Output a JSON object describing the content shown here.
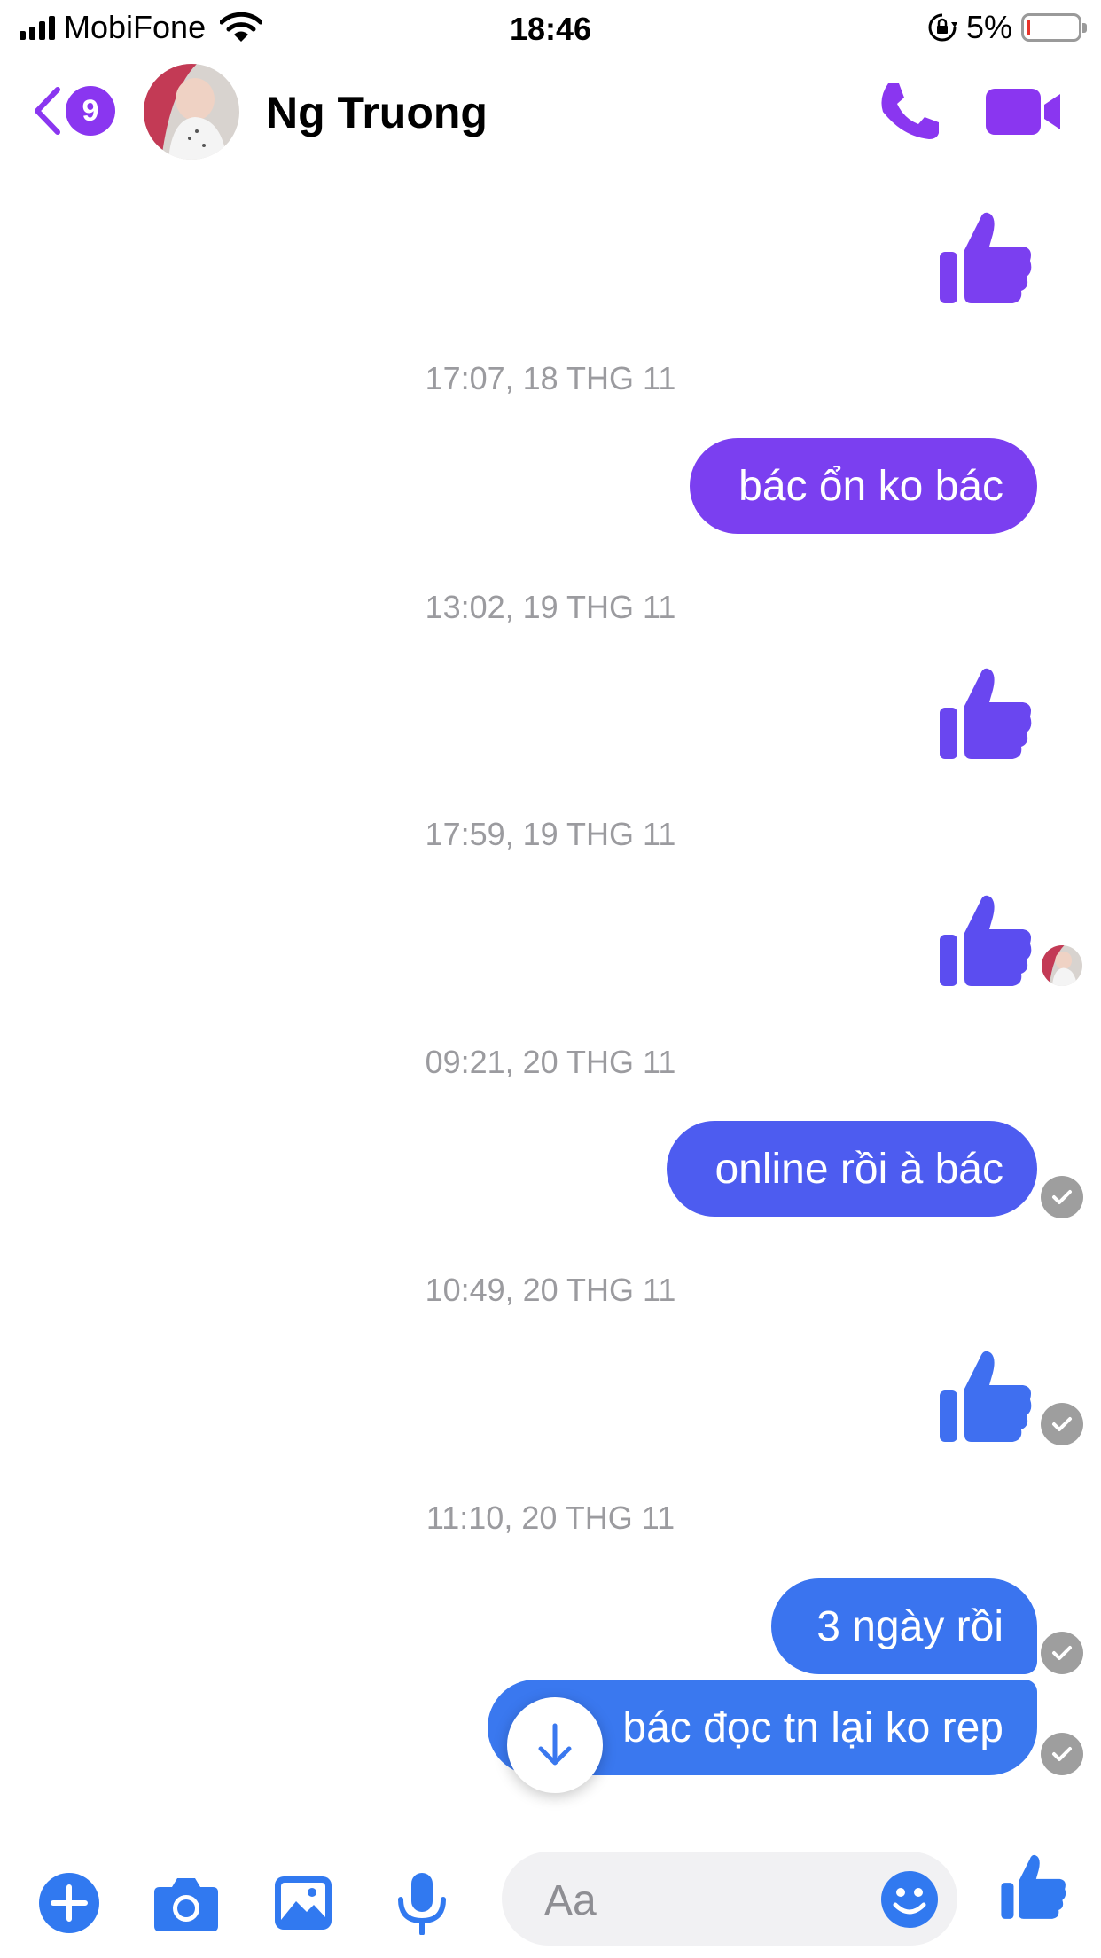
{
  "status_bar": {
    "carrier": "MobiFone",
    "time": "18:46",
    "battery": "5%",
    "battery_level": 0.05
  },
  "header": {
    "back_badge": "9",
    "contact_name": "Ng Truong"
  },
  "messages": {
    "ts1": "17:07, 18 THG 11",
    "msg1": "bác ổn ko bác",
    "ts2": "13:02, 19 THG 11",
    "ts3": "17:59, 19 THG 11",
    "ts4": "09:21, 20 THG 11",
    "msg2": "online rồi à bác",
    "ts5": "10:49, 20 THG 11",
    "ts6": "11:10, 20 THG 11",
    "msg3": "3 ngày rồi",
    "msg4": "bác đọc tn lại ko rep"
  },
  "composer": {
    "placeholder": "Aa"
  },
  "colors": {
    "purple": "#8a36f0",
    "violet": "#7b3ff0",
    "indigo": "#5b4df0",
    "blue": "#3f6ff0",
    "deep_blue": "#3a78ef",
    "composer_blue": "#3179f0"
  }
}
